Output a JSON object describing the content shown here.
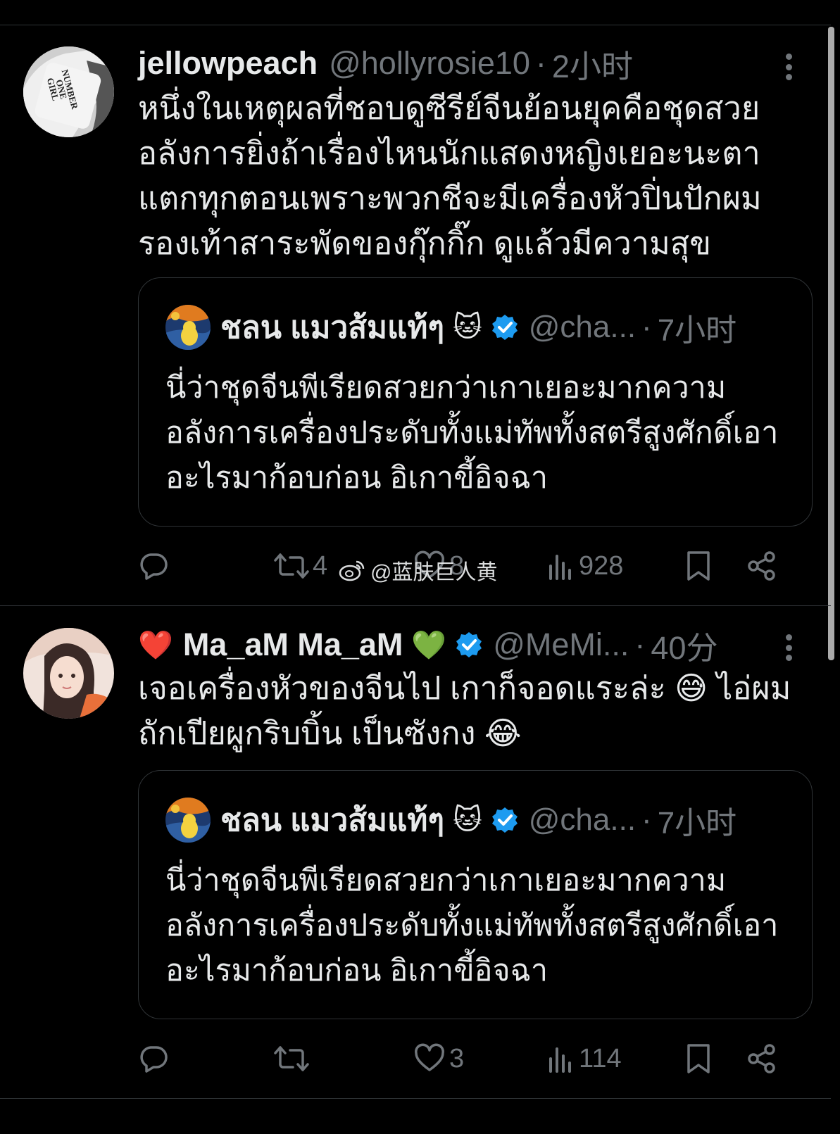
{
  "tweets": [
    {
      "display_name": "jellowpeach",
      "handle": "@hollyrosie10",
      "time": "2小时",
      "avatar_text": "NUMBER ONE GIRL",
      "body": "หนึ่งในเหตุผลที่ชอบดูซีรีย์จีนย้อนยุคคือชุดสวยอลังการยิ่งถ้าเรื่องไหนนักแสดงหญิงเยอะนะตาแตกทุกตอนเพราะพวกชีจะมีเครื่องหัวปิ่นปักผมรองเท้าสาระพัดของกุ๊กกิ๊ก ดูแล้วมีความสุข",
      "quote": {
        "display_name": "ชลน แมวส้มแท้ๆ",
        "emoji": "🐱",
        "handle": "@cha...",
        "time": "7小时",
        "body": "นี่ว่าชุดจีนพีเรียดสวยกว่าเกาเยอะมากความอลังการเครื่องประดับทั้งแม่ทัพทั้งสตรีสูงศักดิ์เอาอะไรมาก้อบก่อน อิเกาขี้อิจฉา"
      },
      "stats": {
        "reposts": "4",
        "likes": "8",
        "views": "928"
      }
    },
    {
      "display_name": "Ma_aM Ma_aM",
      "name_prefix_emoji": "❤️",
      "name_suffix_emoji": "💚",
      "handle": "@MeMi...",
      "time": "40分",
      "body": "เจอเครื่องหัวของจีนไป เกาก็จอดแระล่ะ 😅 ไอ่ผมถักเปียผูกริบบิ้น เป็นซังกง 😂",
      "quote": {
        "display_name": "ชลน แมวส้มแท้ๆ",
        "emoji": "🐱",
        "handle": "@cha...",
        "time": "7小时",
        "body": "นี่ว่าชุดจีนพีเรียดสวยกว่าเกาเยอะมากความอลังการเครื่องประดับทั้งแม่ทัพทั้งสตรีสูงศักดิ์เอาอะไรมาก้อบก่อน อิเกาขี้อิจฉา"
      },
      "stats": {
        "reposts": "",
        "likes": "3",
        "views": "114"
      }
    }
  ],
  "watermark": "@蓝肤巨人黄",
  "colors": {
    "background": "#000000",
    "text": "#e7e9ea",
    "muted": "#71767b",
    "border": "#2f3336",
    "verified": "#1d9bf0"
  },
  "icons": [
    "reply-icon",
    "repost-icon",
    "like-icon",
    "views-icon",
    "bookmark-icon",
    "share-icon",
    "more-icon",
    "verified-badge-icon",
    "weibo-icon"
  ]
}
